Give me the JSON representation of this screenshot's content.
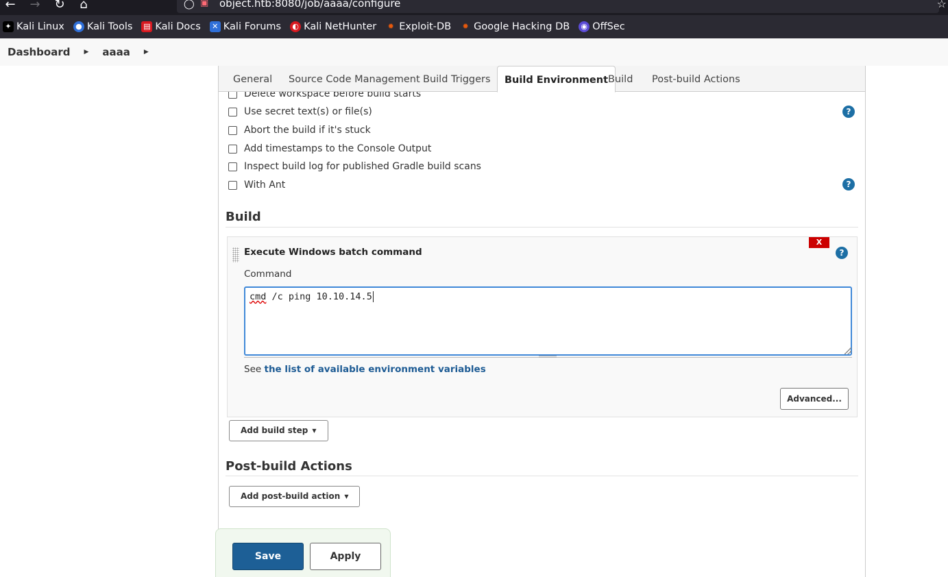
{
  "browser": {
    "url": "object.htb:8080/job/aaaa/configure",
    "bookmarks": [
      {
        "label": "Kali Linux",
        "color": "#000000"
      },
      {
        "label": "Kali Tools",
        "color": "#2f6fd8"
      },
      {
        "label": "Kali Docs",
        "color": "#d71920"
      },
      {
        "label": "Kali Forums",
        "color": "#2f6fd8"
      },
      {
        "label": "Kali NetHunter",
        "color": "#d71920"
      },
      {
        "label": "Exploit-DB",
        "color": "#e8590c"
      },
      {
        "label": "Google Hacking DB",
        "color": "#e8590c"
      },
      {
        "label": "OffSec",
        "color": "#5b4bd6"
      }
    ]
  },
  "breadcrumb": {
    "items": [
      "Dashboard",
      "aaaa"
    ]
  },
  "tabs": [
    {
      "label": "General"
    },
    {
      "label": "Source Code Management"
    },
    {
      "label": "Build Triggers"
    },
    {
      "label": "Build Environment"
    },
    {
      "label": "Build"
    },
    {
      "label": "Post-build Actions"
    }
  ],
  "build_environment": {
    "options": [
      "Delete workspace before build starts",
      "Use secret text(s) or file(s)",
      "Abort the build if it's stuck",
      "Add timestamps to the Console Output",
      "Inspect build log for published Gradle build scans",
      "With Ant"
    ]
  },
  "build": {
    "title": "Build",
    "step": {
      "title": "Execute Windows batch command",
      "delete_label": "X",
      "command_label": "Command",
      "command_prefix": "cmd",
      "command_rest": " /c ping 10.10.14.5",
      "env_prefix": "See ",
      "env_link": "the list of available environment variables",
      "advanced_label": "Advanced..."
    },
    "add_step_label": "Add build step"
  },
  "post_build": {
    "title": "Post-build Actions",
    "add_action_label": "Add post-build action"
  },
  "footer": {
    "save_label": "Save",
    "apply_label": "Apply"
  },
  "icons": {
    "help": "?",
    "caret": "▼"
  },
  "colors": {
    "jenkins_blue": "#1d5f96",
    "link_blue": "#1d5b94",
    "help_blue": "#1d6fa5",
    "delete_red": "#cc0000",
    "focus_blue": "#3f88d8"
  }
}
